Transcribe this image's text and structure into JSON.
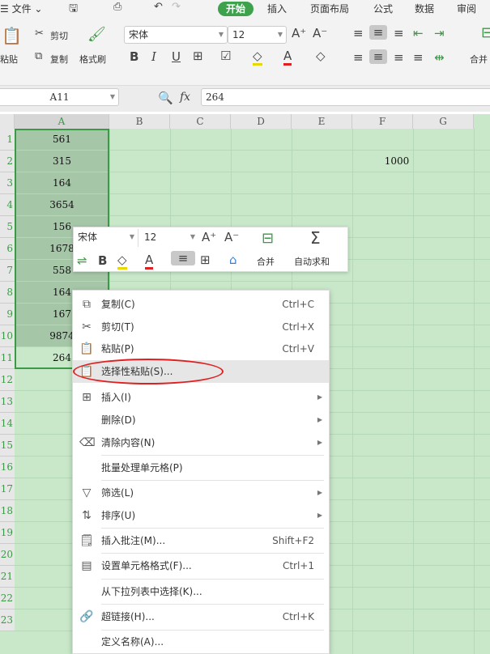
{
  "tabs": {
    "file": "文件",
    "items": [
      "开始",
      "插入",
      "页面布局",
      "公式",
      "数据",
      "审阅"
    ]
  },
  "ribbon": {
    "paste": "粘贴",
    "cut": "剪切",
    "copy": "复制",
    "format_painter": "格式刷",
    "font": "宋体",
    "size": "12",
    "merge": "合并"
  },
  "formula_bar": {
    "cell_ref": "A11",
    "fx": "fx",
    "value": "264"
  },
  "columns": [
    "A",
    "B",
    "C",
    "D",
    "E",
    "F",
    "G"
  ],
  "rows": [
    "1",
    "2",
    "3",
    "4",
    "5",
    "6",
    "7",
    "8",
    "9",
    "10",
    "11",
    "12",
    "13",
    "14",
    "15",
    "16",
    "17",
    "18",
    "19",
    "20",
    "21",
    "22",
    "23"
  ],
  "column_a": [
    "561",
    "315",
    "164",
    "3654",
    "156",
    "1678",
    "558",
    "164",
    "167",
    "9874",
    "264"
  ],
  "f2": "1000",
  "mini_toolbar": {
    "font": "宋体",
    "size": "12",
    "merge": "合并",
    "autosum": "自动求和"
  },
  "context_menu": [
    {
      "icon": "copy-icon",
      "label": "复制(C)",
      "shortcut": "Ctrl+C"
    },
    {
      "icon": "cut-icon",
      "label": "剪切(T)",
      "shortcut": "Ctrl+X"
    },
    {
      "icon": "paste-icon",
      "label": "粘贴(P)",
      "shortcut": "Ctrl+V"
    },
    {
      "icon": "paste-special-icon",
      "label": "选择性粘贴(S)...",
      "shortcut": ""
    },
    {
      "icon": "insert-icon",
      "label": "插入(I)",
      "shortcut": ""
    },
    {
      "icon": "",
      "label": "删除(D)",
      "shortcut": ""
    },
    {
      "icon": "clear-icon",
      "label": "清除内容(N)",
      "shortcut": ""
    },
    {
      "icon": "",
      "label": "批量处理单元格(P)",
      "shortcut": ""
    },
    {
      "icon": "filter-icon",
      "label": "筛选(L)",
      "shortcut": ""
    },
    {
      "icon": "sort-icon",
      "label": "排序(U)",
      "shortcut": ""
    },
    {
      "icon": "comment-icon",
      "label": "插入批注(M)...",
      "shortcut": "Shift+F2"
    },
    {
      "icon": "format-cells-icon",
      "label": "设置单元格格式(F)...",
      "shortcut": "Ctrl+1"
    },
    {
      "icon": "",
      "label": "从下拉列表中选择(K)...",
      "shortcut": ""
    },
    {
      "icon": "link-icon",
      "label": "超链接(H)...",
      "shortcut": "Ctrl+K"
    },
    {
      "icon": "",
      "label": "定义名称(A)...",
      "shortcut": ""
    }
  ]
}
